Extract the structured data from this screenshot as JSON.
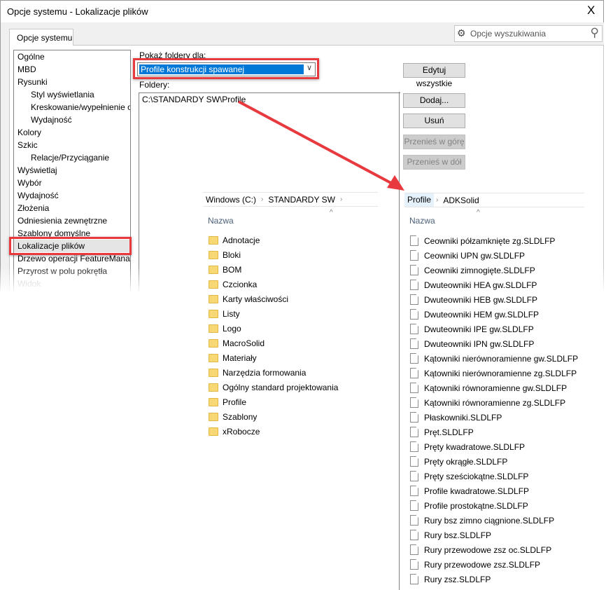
{
  "window": {
    "title": "Opcje systemu - Lokalizacje plików",
    "close": "X"
  },
  "tab": "Opcje systemu",
  "search": {
    "placeholder": "Opcje wyszukiwania"
  },
  "tree": [
    {
      "label": "Ogólne",
      "level": 0
    },
    {
      "label": "MBD",
      "level": 0
    },
    {
      "label": "Rysunki",
      "level": 0
    },
    {
      "label": "Styl wyświetlania",
      "level": 1
    },
    {
      "label": "Kreskowanie/wypełnienie obszaru",
      "level": 1
    },
    {
      "label": "Wydajność",
      "level": 1
    },
    {
      "label": "Kolory",
      "level": 0
    },
    {
      "label": "Szkic",
      "level": 0
    },
    {
      "label": "Relacje/Przyciąganie",
      "level": 1
    },
    {
      "label": "Wyświetlaj",
      "level": 0
    },
    {
      "label": "Wybór",
      "level": 0
    },
    {
      "label": "Wydajność",
      "level": 0
    },
    {
      "label": "Złożenia",
      "level": 0
    },
    {
      "label": "Odniesienia zewnętrzne",
      "level": 0
    },
    {
      "label": "Szablony domyślne",
      "level": 0
    },
    {
      "label": "Lokalizacje plików",
      "level": 0,
      "selected": true
    },
    {
      "label": "Drzewo operacji FeatureManager",
      "level": 0
    },
    {
      "label": "Przyrost w polu pokrętła",
      "level": 0
    },
    {
      "label": "Widok",
      "level": 0,
      "disabled": true
    }
  ],
  "main": {
    "show_folders_label": "Pokaż foldery dla:",
    "show_folders_value": "Profile konstrukcji spawanej",
    "folders_label": "Foldery:",
    "folders": [
      "C:\\STANDARDY SW\\Profile"
    ],
    "buttons": {
      "edit_all": "Edytuj wszystkie",
      "add": "Dodaj...",
      "remove": "Usuń",
      "move_up": "Przenieś w górę",
      "move_down": "Przenieś w dół"
    }
  },
  "explorer_left": {
    "breadcrumb": [
      "Windows (C:)",
      "STANDARDY SW"
    ],
    "column": "Nazwa",
    "items": [
      "Adnotacje",
      "Bloki",
      "BOM",
      "Czcionka",
      "Karty właściwości",
      "Listy",
      "Logo",
      "MacroSolid",
      "Materiały",
      "Narzędzia formowania",
      "Ogólny standard projektowania",
      "Profile",
      "Szablony",
      "xRobocze"
    ]
  },
  "explorer_right": {
    "breadcrumb": [
      "Profile",
      "ADKSolid"
    ],
    "column": "Nazwa",
    "items": [
      "Ceowniki półzamknięte zg.SLDLFP",
      "Ceowniki UPN gw.SLDLFP",
      "Ceowniki zimnogięte.SLDLFP",
      "Dwuteowniki HEA gw.SLDLFP",
      "Dwuteowniki HEB gw.SLDLFP",
      "Dwuteowniki HEM gw.SLDLFP",
      "Dwuteowniki IPE gw.SLDLFP",
      "Dwuteowniki IPN gw.SLDLFP",
      "Kątowniki nierównoramienne gw.SLDLFP",
      "Kątowniki nierównoramienne zg.SLDLFP",
      "Kątowniki równoramienne gw.SLDLFP",
      "Kątowniki równoramienne zg.SLDLFP",
      "Płaskowniki.SLDLFP",
      "Pręt.SLDLFP",
      "Pręty kwadratowe.SLDLFP",
      "Pręty okrągłe.SLDLFP",
      "Pręty sześciokątne.SLDLFP",
      "Profile kwadratowe.SLDLFP",
      "Profile prostokątne.SLDLFP",
      "Rury bsz zimno ciągnione.SLDLFP",
      "Rury bsz.SLDLFP",
      "Rury przewodowe zsz oc.SLDLFP",
      "Rury przewodowe zsz.SLDLFP",
      "Rury zsz.SLDLFP"
    ]
  },
  "colors": {
    "highlight": "#e8393f",
    "selection": "#0078d7",
    "folder": "#f8d775"
  }
}
